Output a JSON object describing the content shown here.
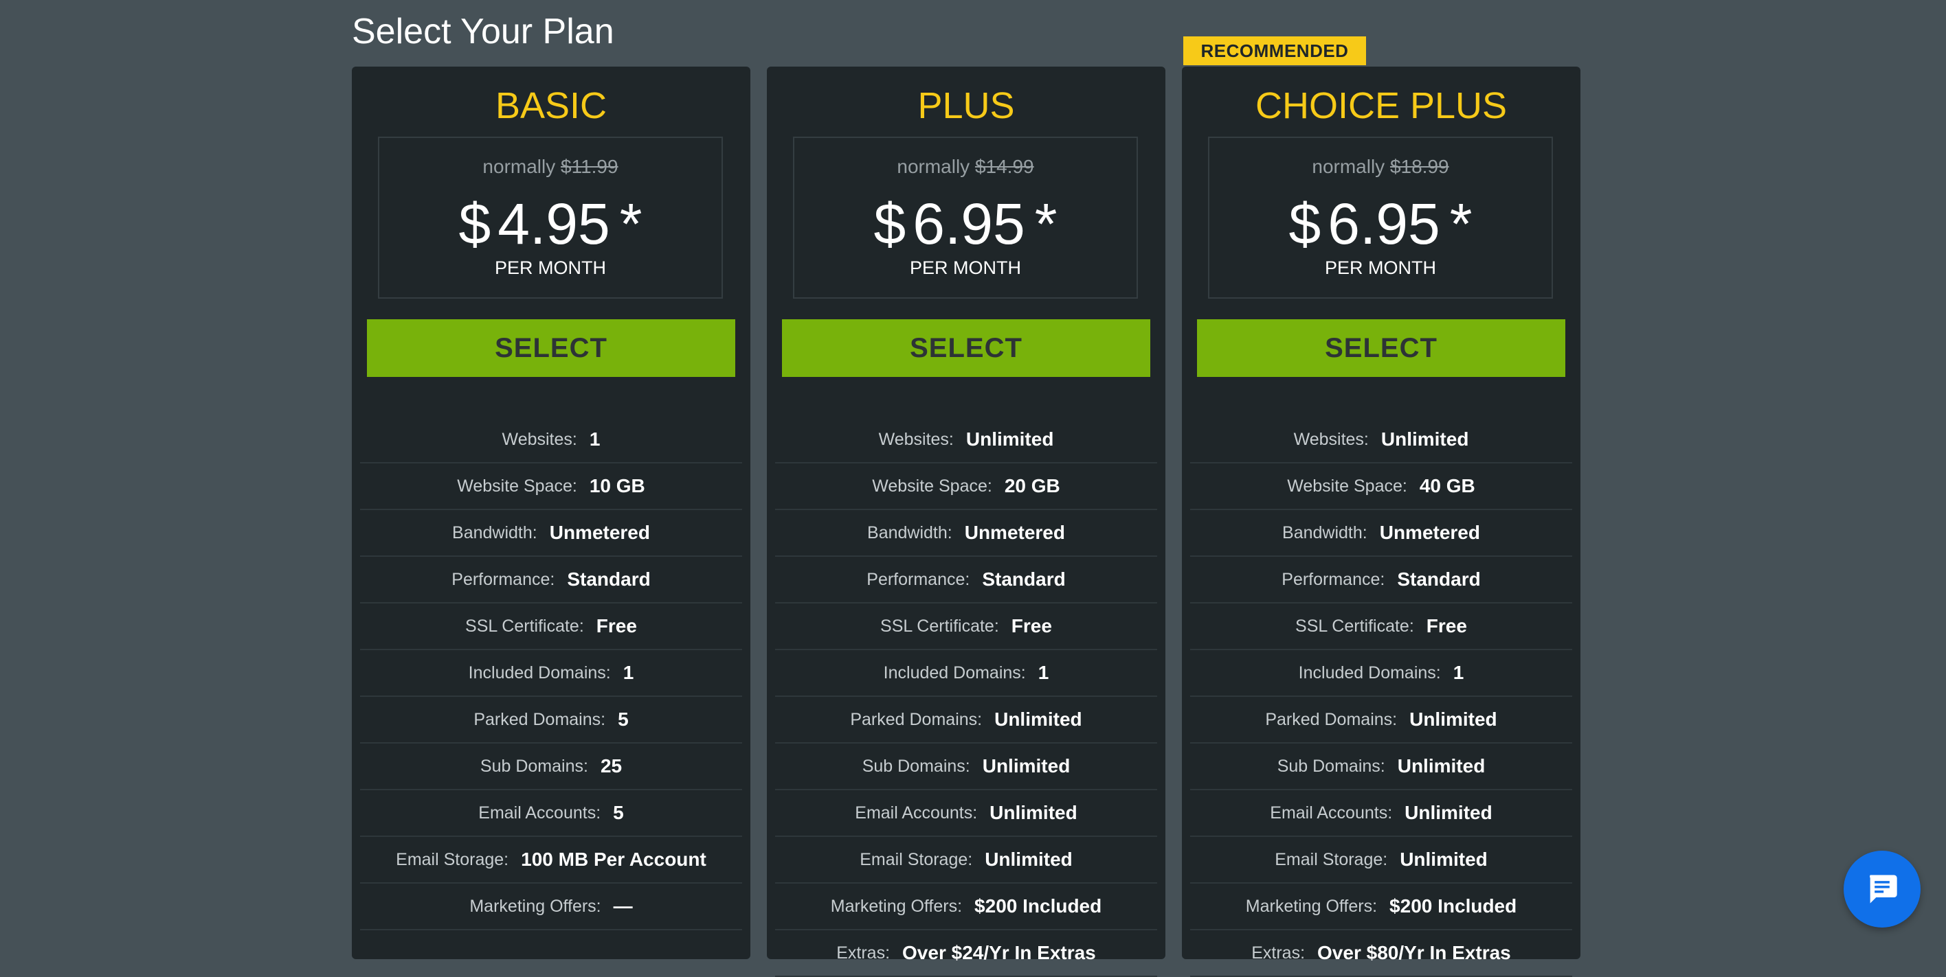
{
  "page": {
    "title": "Select Your Plan"
  },
  "colors": {
    "background": "#465157",
    "card": "#1f2629",
    "accent_yellow": "#f7ca18",
    "select_green": "#78b20b",
    "chat_blue": "#1070e9"
  },
  "plans": [
    {
      "name": "BASIC",
      "badge": "",
      "normally_label": "normally",
      "old_price": "$11.99",
      "currency": "$",
      "price": "4.95",
      "asterisk": "*",
      "period": "PER MONTH",
      "select_label": "SELECT",
      "features": [
        {
          "label": "Websites:",
          "value": "1"
        },
        {
          "label": "Website Space:",
          "value": "10 GB"
        },
        {
          "label": "Bandwidth:",
          "value": "Unmetered"
        },
        {
          "label": "Performance:",
          "value": "Standard"
        },
        {
          "label": "SSL Certificate:",
          "value": "Free"
        },
        {
          "label": "Included Domains:",
          "value": "1"
        },
        {
          "label": "Parked Domains:",
          "value": "5"
        },
        {
          "label": "Sub Domains:",
          "value": "25"
        },
        {
          "label": "Email Accounts:",
          "value": "5"
        },
        {
          "label": "Email Storage:",
          "value": "100 MB Per Account"
        },
        {
          "label": "Marketing Offers:",
          "value": "—"
        }
      ]
    },
    {
      "name": "PLUS",
      "badge": "",
      "normally_label": "normally",
      "old_price": "$14.99",
      "currency": "$",
      "price": "6.95",
      "asterisk": "*",
      "period": "PER MONTH",
      "select_label": "SELECT",
      "features": [
        {
          "label": "Websites:",
          "value": "Unlimited"
        },
        {
          "label": "Website Space:",
          "value": "20 GB"
        },
        {
          "label": "Bandwidth:",
          "value": "Unmetered"
        },
        {
          "label": "Performance:",
          "value": "Standard"
        },
        {
          "label": "SSL Certificate:",
          "value": "Free"
        },
        {
          "label": "Included Domains:",
          "value": "1"
        },
        {
          "label": "Parked Domains:",
          "value": "Unlimited"
        },
        {
          "label": "Sub Domains:",
          "value": "Unlimited"
        },
        {
          "label": "Email Accounts:",
          "value": "Unlimited"
        },
        {
          "label": "Email Storage:",
          "value": "Unlimited"
        },
        {
          "label": "Marketing Offers:",
          "value": "$200 Included"
        },
        {
          "label": "Extras:",
          "value": "Over $24/Yr In Extras"
        }
      ]
    },
    {
      "name": "CHOICE PLUS",
      "badge": "RECOMMENDED",
      "normally_label": "normally",
      "old_price": "$18.99",
      "currency": "$",
      "price": "6.95",
      "asterisk": "*",
      "period": "PER MONTH",
      "select_label": "SELECT",
      "features": [
        {
          "label": "Websites:",
          "value": "Unlimited"
        },
        {
          "label": "Website Space:",
          "value": "40 GB"
        },
        {
          "label": "Bandwidth:",
          "value": "Unmetered"
        },
        {
          "label": "Performance:",
          "value": "Standard"
        },
        {
          "label": "SSL Certificate:",
          "value": "Free"
        },
        {
          "label": "Included Domains:",
          "value": "1"
        },
        {
          "label": "Parked Domains:",
          "value": "Unlimited"
        },
        {
          "label": "Sub Domains:",
          "value": "Unlimited"
        },
        {
          "label": "Email Accounts:",
          "value": "Unlimited"
        },
        {
          "label": "Email Storage:",
          "value": "Unlimited"
        },
        {
          "label": "Marketing Offers:",
          "value": "$200 Included"
        },
        {
          "label": "Extras:",
          "value": "Over $80/Yr In Extras"
        }
      ]
    }
  ],
  "chat": {
    "icon": "chat-bubble-icon"
  }
}
